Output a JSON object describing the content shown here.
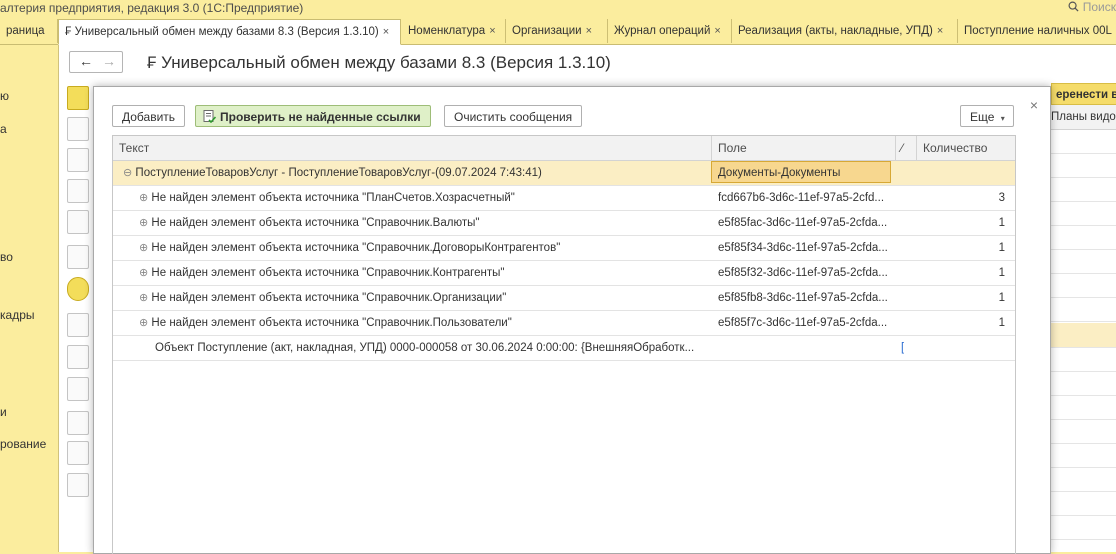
{
  "title": {
    "text": "алтерия предприятия, редакция 3.0  (1С:Предприятие)",
    "search": "Поиск"
  },
  "tabs": [
    {
      "label": "раница"
    },
    {
      "label": "₣ Универсальный обмен между базами 8.3 (Версия 1.3.10)"
    },
    {
      "label": "Номенклатура"
    },
    {
      "label": "Организации"
    },
    {
      "label": "Журнал операций"
    },
    {
      "label": "Реализация (акты, накладные, УПД)"
    },
    {
      "label": "Поступление наличных 00L"
    }
  ],
  "left": [
    "ю",
    "а",
    "во",
    "кадры",
    "и",
    "рование"
  ],
  "main": {
    "title": "₣ Универсальный обмен между базами 8.3 (Версия 1.3.10)",
    "right_button": "еренести в",
    "right_link": "Планы видов"
  },
  "modal": {
    "buttons": {
      "add": "Добавить",
      "check": "Проверить не найденные ссылки",
      "clear": "Очистить сообщения",
      "more": "Еще"
    },
    "columns": {
      "text": "Текст",
      "field": "Поле",
      "qty": "Количество"
    },
    "rows": [
      {
        "text": "ПоступлениеТоваровУслуг - ПоступлениеТоваровУслуг-(09.07.2024 7:43:41)",
        "field": "Документы-Документы",
        "qty": ""
      },
      {
        "text": "Не найден элемент объекта источника \"ПланСчетов.Хозрасчетный\"",
        "field": "fcd667b6-3d6c-11ef-97a5-2cfd...",
        "qty": "3"
      },
      {
        "text": "Не найден элемент объекта источника \"Справочник.Валюты\"",
        "field": "e5f85fac-3d6c-11ef-97a5-2cfda...",
        "qty": "1"
      },
      {
        "text": "Не найден элемент объекта источника \"Справочник.ДоговорыКонтрагентов\"",
        "field": "e5f85f34-3d6c-11ef-97a5-2cfda...",
        "qty": "1"
      },
      {
        "text": "Не найден элемент объекта источника \"Справочник.Контрагенты\"",
        "field": "e5f85f32-3d6c-11ef-97a5-2cfda...",
        "qty": "1"
      },
      {
        "text": "Не найден элемент объекта источника \"Справочник.Организации\"",
        "field": "e5f85fb8-3d6c-11ef-97a5-2cfda...",
        "qty": "1"
      },
      {
        "text": "Не найден элемент объекта источника \"Справочник.Пользователи\"",
        "field": "e5f85f7c-3d6c-11ef-97a5-2cfda...",
        "qty": "1"
      },
      {
        "text": "Объект Поступление (акт, накладная, УПД) 0000-000058 от 30.06.2024 0:00:00: {ВнешняяОбработк...",
        "field": "",
        "qty": ""
      }
    ]
  }
}
